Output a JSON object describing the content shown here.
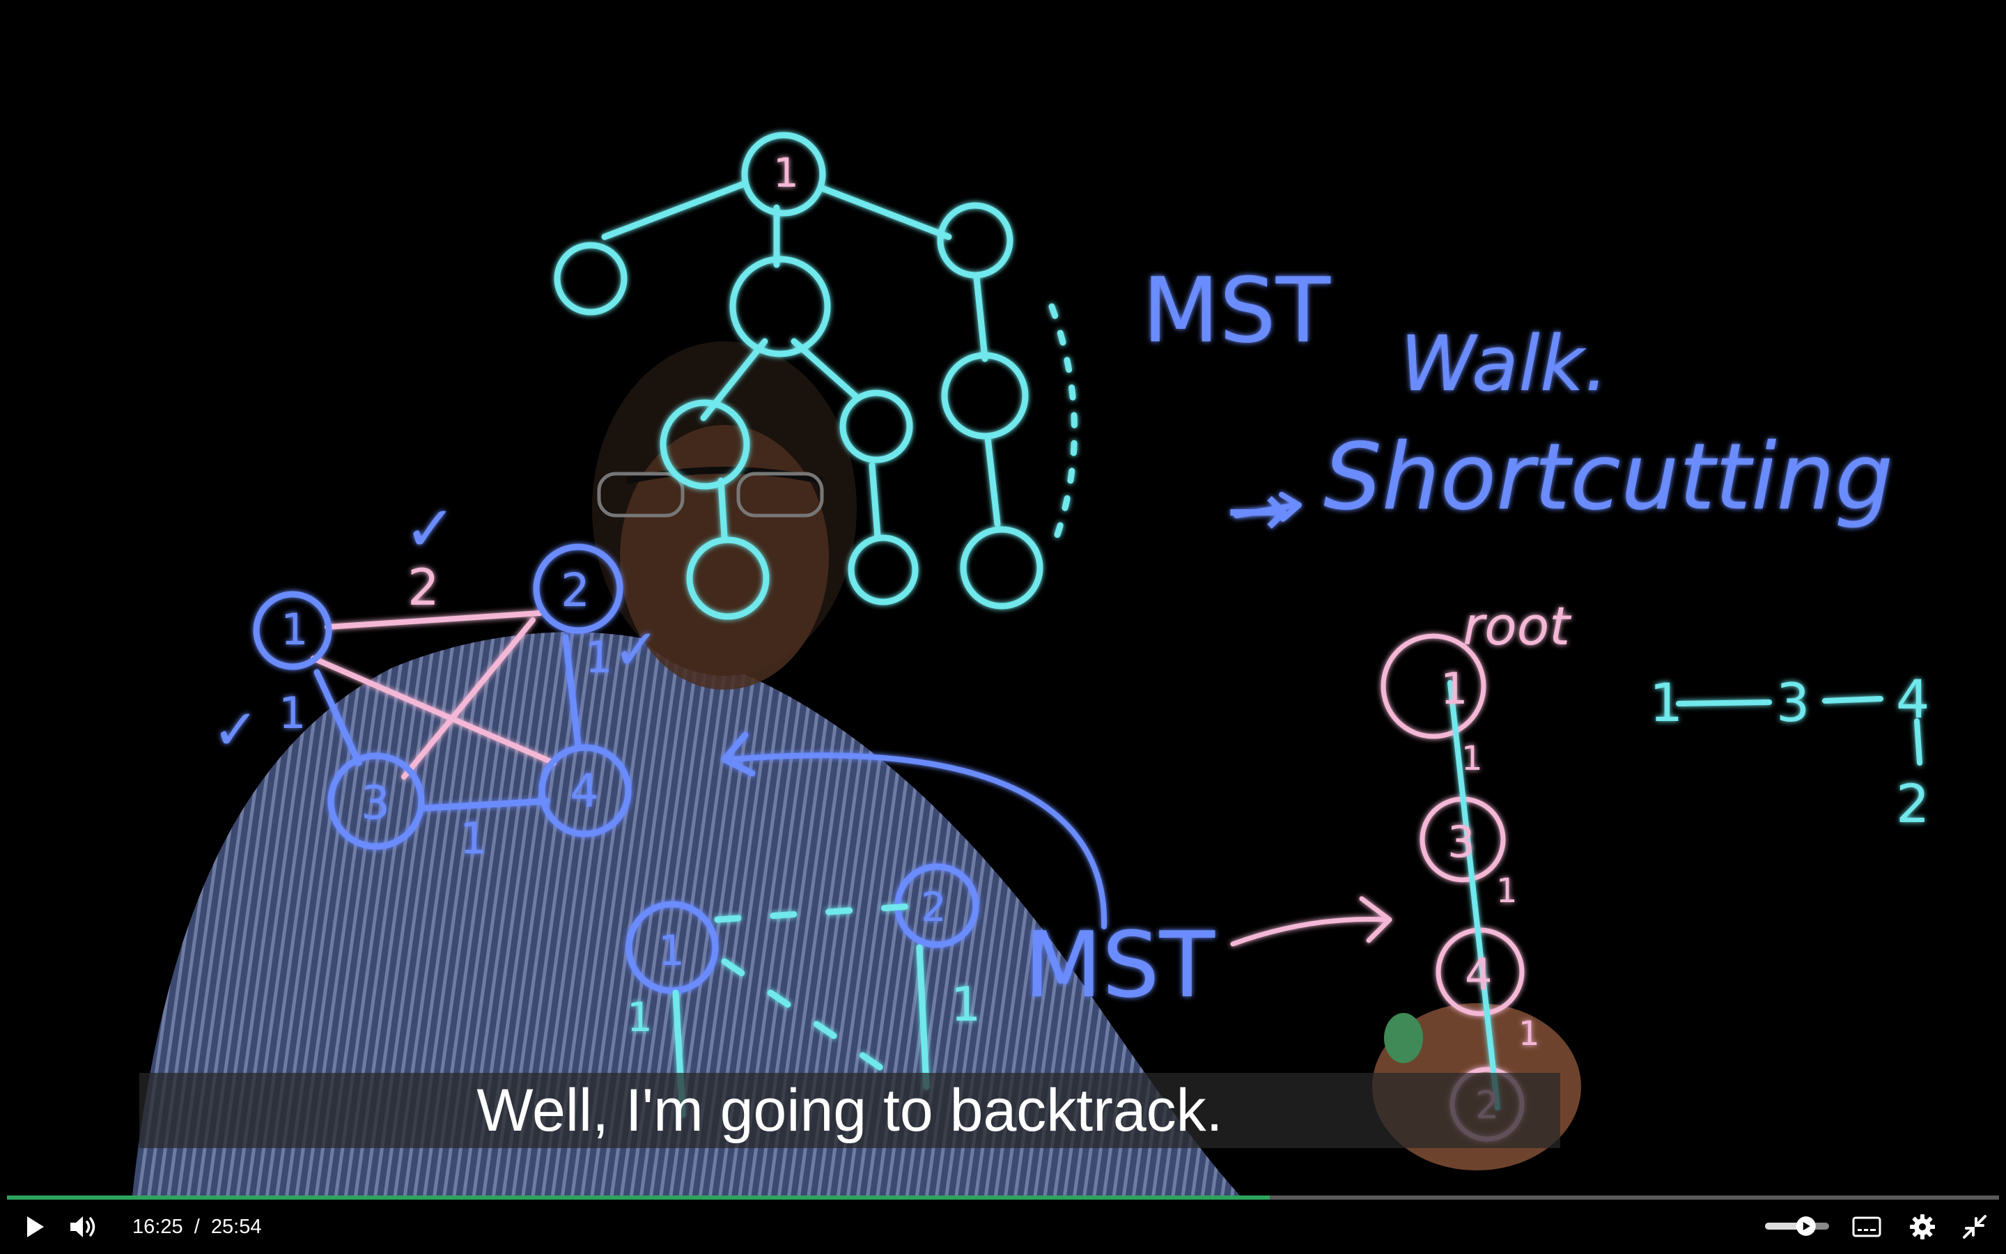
{
  "video": {
    "caption": "Well, I'm going to backtrack.",
    "progress_fraction": 0.634,
    "volume_fraction": 0.7
  },
  "board": {
    "mst_title": "MST",
    "walk_label": "Walk.",
    "shortcutting_arrow": "→",
    "shortcutting_label": "Shortcutting",
    "root_label": "root",
    "mst_label_bottom": "MST",
    "graph_nodes": [
      "1",
      "2",
      "3",
      "4"
    ],
    "edge_weights": {
      "w12": "2",
      "w13": "1",
      "w24": "1",
      "w34": "1"
    },
    "checkmarks": [
      "✓",
      "✓",
      "✓"
    ],
    "tree_root": "1",
    "mst_chain": [
      "1",
      "3",
      "4",
      "2"
    ],
    "chain_weights": [
      "1",
      "1",
      "1"
    ],
    "sequence": [
      "1",
      "3",
      "4",
      "2"
    ],
    "bottom_nodes": [
      "1",
      "2"
    ],
    "bottom_weights": [
      "1",
      "1"
    ]
  },
  "controls": {
    "current_time": "16:25",
    "separator": "/",
    "duration": "25:54"
  },
  "colors": {
    "chalk_cyan": "#6fe8ec",
    "chalk_blue": "#6a8cff",
    "chalk_pink": "#f4b8d6",
    "progress": "#2ea35d"
  }
}
